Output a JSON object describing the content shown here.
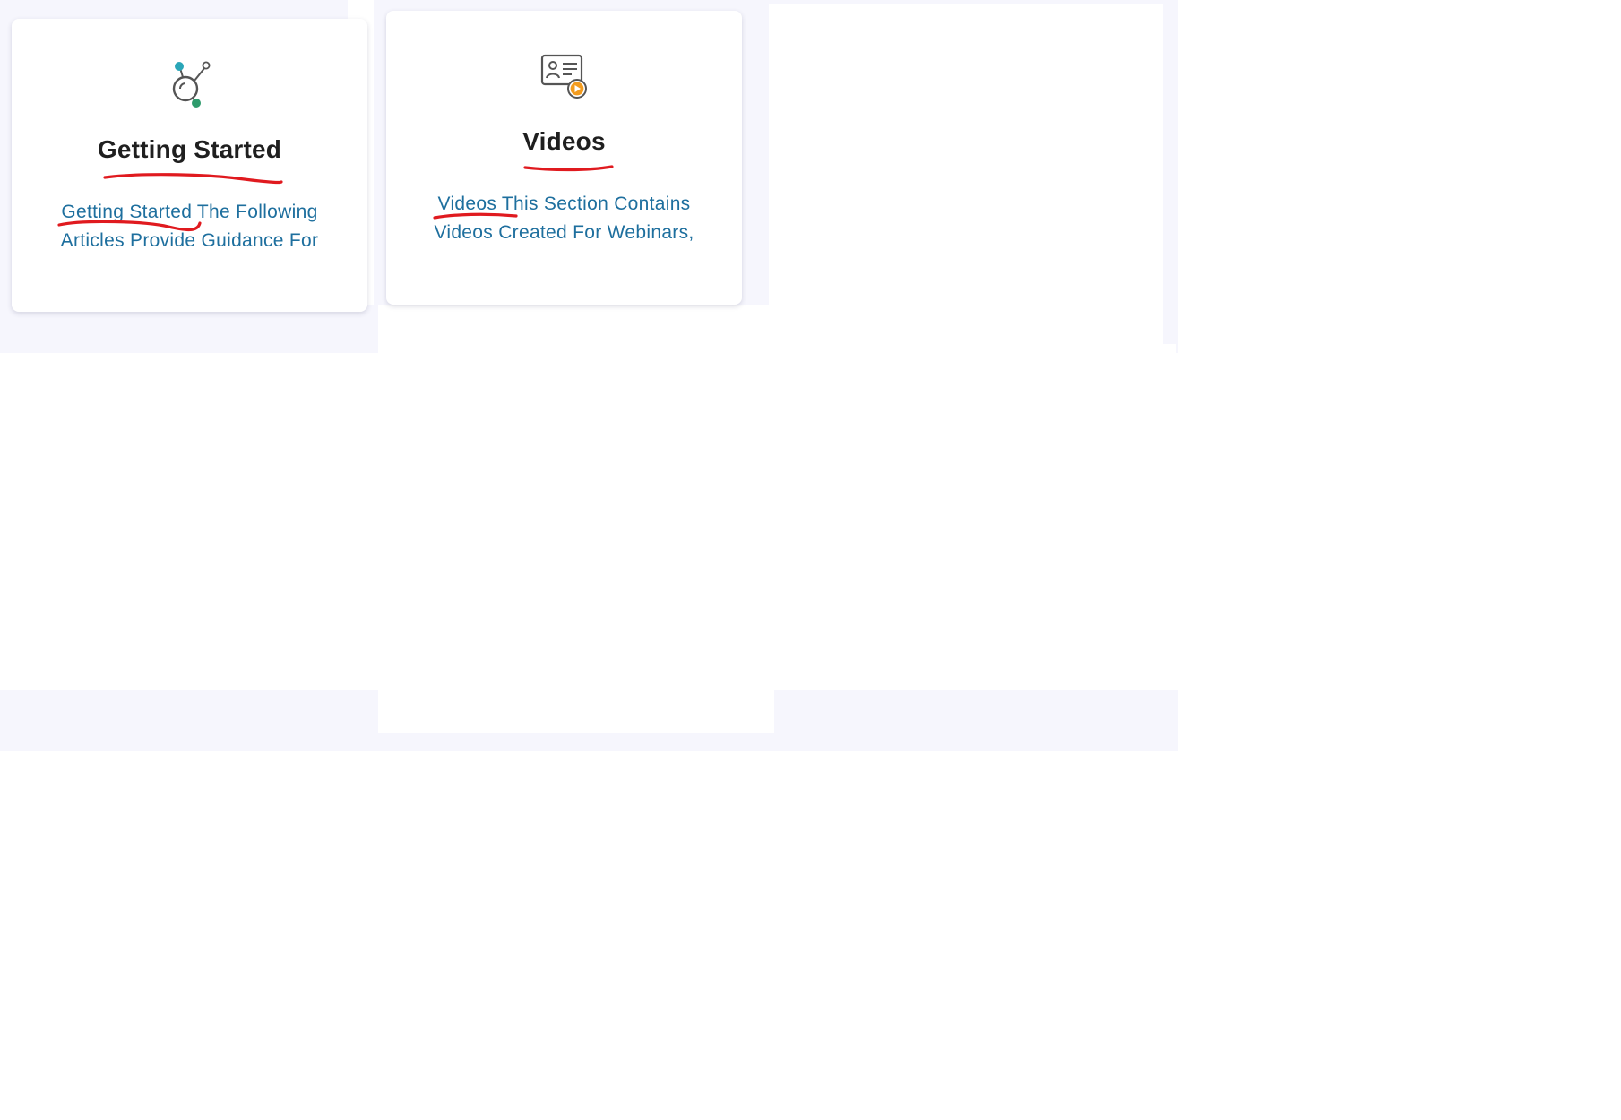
{
  "cards": [
    {
      "icon": "network-nodes-icon",
      "title": "Getting Started",
      "description_highlight": "Getting Started",
      "description_rest": " The Following Articles Provide Guidance For"
    },
    {
      "icon": "video-id-card-icon",
      "title": "Videos",
      "description_highlight": "Videos",
      "description_rest": " This Section Contains Videos Created For Webinars,"
    }
  ],
  "colors": {
    "background": "#f6f6fd",
    "card": "#ffffff",
    "title": "#1f1f1f",
    "description": "#1e6f9e",
    "annotation": "#e01a1f",
    "icon_teal": "#2aa6b8",
    "icon_green": "#2e9b6c",
    "icon_orange": "#f39c1f",
    "icon_gray": "#555555"
  }
}
